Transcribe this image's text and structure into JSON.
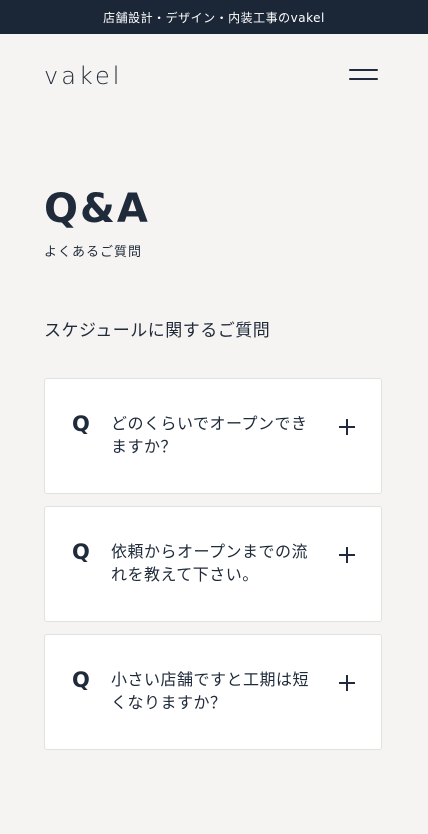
{
  "topbar": {
    "text": "店舗設計・デザイン・内装工事のvakel"
  },
  "header": {
    "logo": "vakel",
    "menu_icon": "hamburger-menu-icon"
  },
  "page": {
    "title": "Q&A",
    "subtitle": "よくあるご質問"
  },
  "section": {
    "title": "スケジュールに関するご質問"
  },
  "faq": {
    "q_label": "Q",
    "items": [
      {
        "question": "どのくらいでオープンできますか？",
        "icon": "plus-icon"
      },
      {
        "question": "依頼からオープンまでの流れを教えて下さい。",
        "icon": "plus-icon"
      },
      {
        "question": "小さい店舗ですと工期は短くなりますか？",
        "icon": "plus-icon"
      }
    ]
  }
}
